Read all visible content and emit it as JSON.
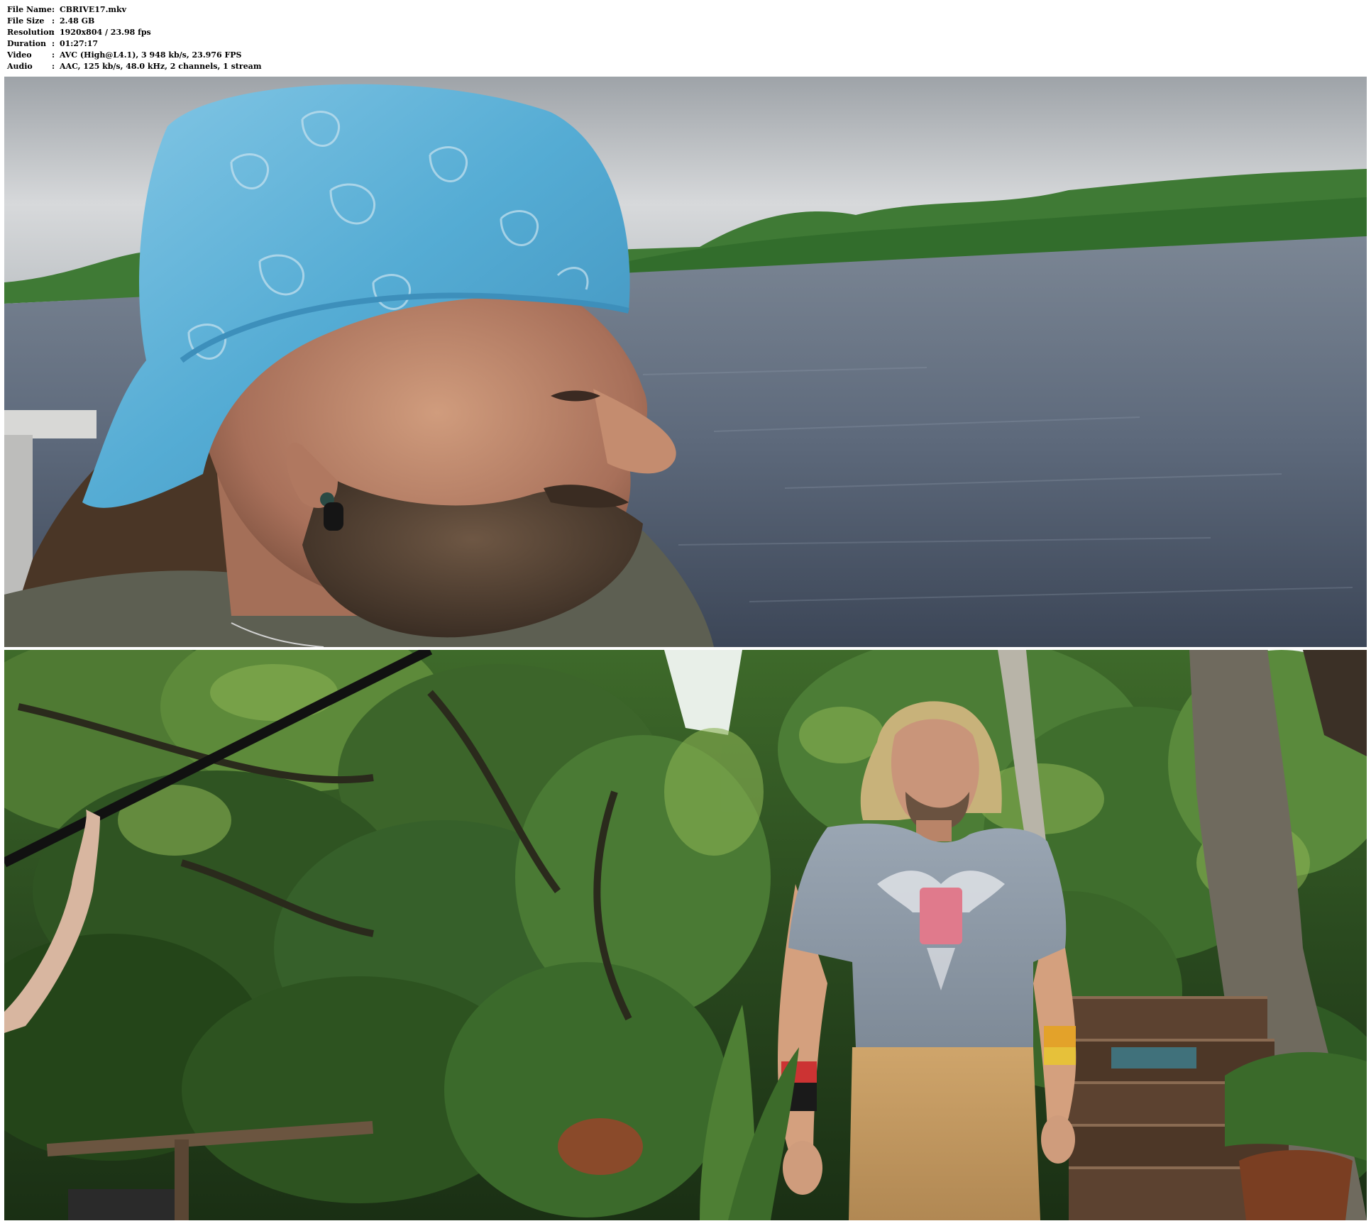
{
  "media_info": {
    "rows": [
      {
        "key": "File Name",
        "sep": ":",
        "value": "CBRIVE17.mkv"
      },
      {
        "key": "File Size",
        "sep": ":",
        "value": "2.48 GB"
      },
      {
        "key": "Resolution",
        "sep": ":",
        "value": "1920x804 / 23.98 fps"
      },
      {
        "key": "Duration",
        "sep": ":",
        "value": "01:27:17"
      },
      {
        "key": "Video",
        "sep": ":",
        "value": "AVC (High@L4.1), 3 948 kb/s, 23.976 FPS"
      },
      {
        "key": "Audio",
        "sep": ":",
        "value": "AAC, 125 kb/s, 48.0 kHz, 2 channels, 1 stream"
      }
    ]
  },
  "frames": [
    {
      "scene": "river-closeup",
      "colors": {
        "sky": "#c9cccf",
        "treeline": "#3f7a35",
        "water": "#5f6c7f",
        "bandana": "#5fb3d6",
        "skin": "#b98468",
        "beard": "#5a4838",
        "shirt": "#5d5f52"
      }
    },
    {
      "scene": "jungle-garden",
      "colors": {
        "foliage_dark": "#1d3a1a",
        "foliage_mid": "#3d6b2c",
        "foliage_light": "#7aa04a",
        "tshirt": "#8c98a6",
        "trousers": "#c49b62",
        "hair": "#c8b27a",
        "stairs": "#5c4230"
      }
    }
  ]
}
